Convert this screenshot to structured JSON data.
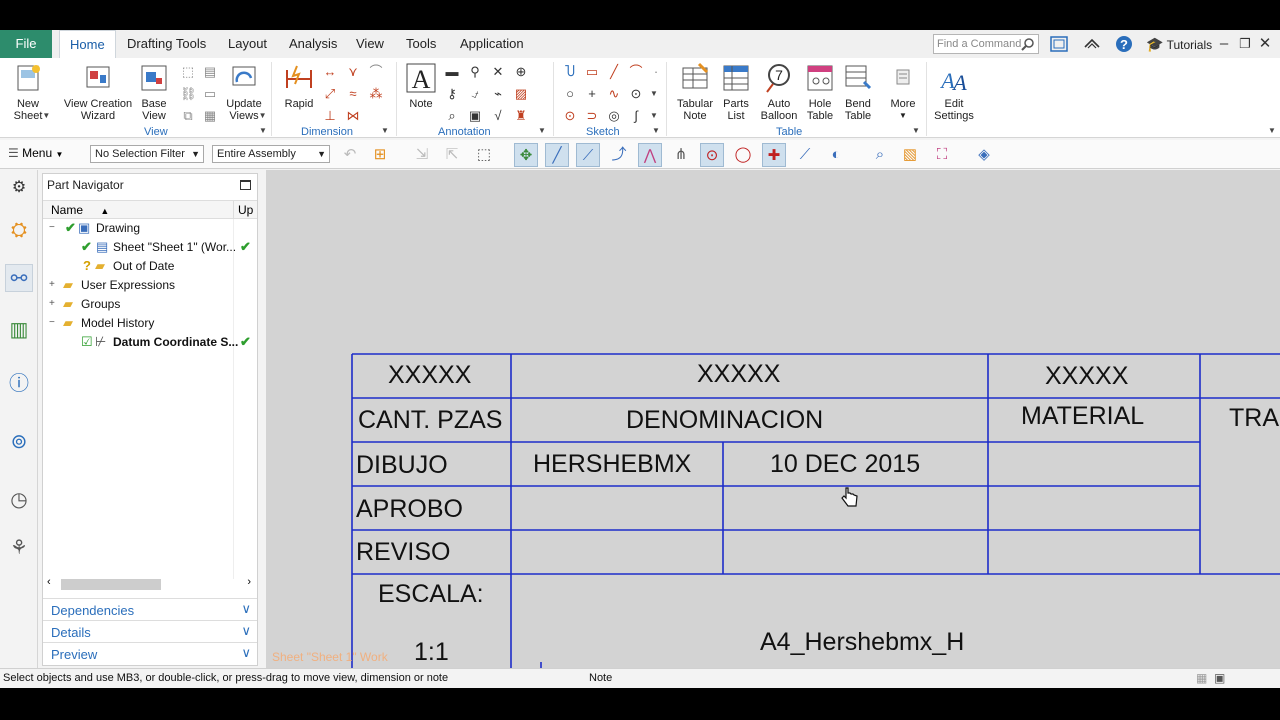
{
  "tabs": [
    "File",
    "Home",
    "Drafting Tools",
    "Layout",
    "Analysis",
    "View",
    "Tools",
    "Application"
  ],
  "search_placeholder": "Find a Command",
  "tutorials_label": "Tutorials",
  "ribbon": {
    "new_sheet": "New\nSheet",
    "view_creation_wizard": "View Creation\nWizard",
    "base_view": "Base\nView",
    "update_views": "Update\nViews",
    "rapid": "Rapid",
    "note": "Note",
    "tabular_note": "Tabular\nNote",
    "parts_list": "Parts\nList",
    "auto_balloon": "Auto\nBalloon",
    "hole_table": "Hole\nTable",
    "bend_table": "Bend\nTable",
    "more": "More",
    "edit_settings": "Edit\nSettings",
    "groups": {
      "view": "View",
      "dimension": "Dimension",
      "annotation": "Annotation",
      "sketch": "Sketch",
      "table": "Table"
    }
  },
  "toolbar": {
    "menu": "Menu",
    "selection_filter": "No Selection Filter",
    "scope": "Entire Assembly"
  },
  "navigator": {
    "title": "Part Navigator",
    "col_name": "Name",
    "col_up": "Up",
    "rows": [
      {
        "label": "Drawing"
      },
      {
        "label": "Sheet \"Sheet 1\" (Wor..."
      },
      {
        "label": "Out of Date"
      },
      {
        "label": "User Expressions"
      },
      {
        "label": "Groups"
      },
      {
        "label": "Model History"
      },
      {
        "label": "Datum Coordinate S..."
      }
    ],
    "panels": [
      "Dependencies",
      "Details",
      "Preview"
    ]
  },
  "title_block": {
    "r1c1": "XXXXX",
    "r1c2": "XXXXX",
    "r1c3": "XXXXX",
    "r2c1": "CANT. PZAS",
    "r2c2": "DENOMINACION",
    "r2c3": "MATERIAL",
    "r2c4": "TRA",
    "r3c1": "DIBUJO",
    "r3c2": "HERSHEBMX",
    "r3c3": "10 DEC 2015",
    "r4c1": "APROBO",
    "r5c1": "REVISO",
    "escala": "ESCALA:",
    "scale": "1:1",
    "drawing_name": "A4_Hershebmx_H"
  },
  "sheet_label": "Sheet \"Sheet 1\" Work",
  "status": {
    "message": "Select objects and use MB3, or double-click, or press-drag to move view, dimension or note",
    "mode": "Note"
  },
  "colors": {
    "file_tab": "#2d8c6c",
    "accent": "#2a6ebb",
    "border_line": "#1d2cc9"
  }
}
